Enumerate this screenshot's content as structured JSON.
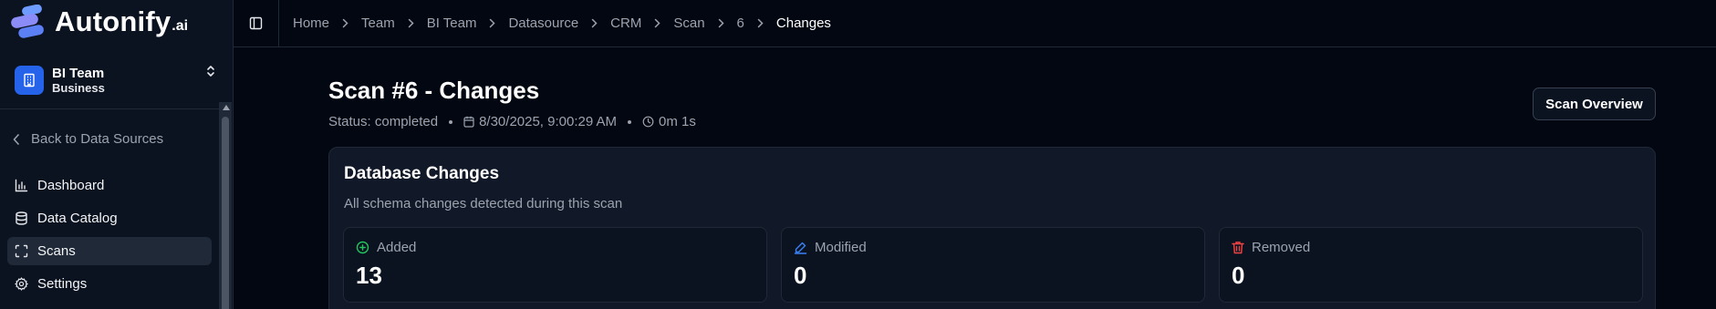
{
  "brand": {
    "name": "Autonify",
    "suffix": ".ai"
  },
  "team": {
    "name": "BI Team",
    "plan": "Business"
  },
  "sidebar": {
    "back_label": "Back to Data Sources",
    "items": [
      {
        "label": "Dashboard",
        "icon": "bar-chart-icon"
      },
      {
        "label": "Data Catalog",
        "icon": "database-icon"
      },
      {
        "label": "Scans",
        "icon": "scan-icon",
        "active": true
      },
      {
        "label": "Settings",
        "icon": "gear-icon"
      }
    ]
  },
  "breadcrumb": [
    "Home",
    "Team",
    "BI Team",
    "Datasource",
    "CRM",
    "Scan",
    "6",
    "Changes"
  ],
  "page": {
    "title": "Scan #6 - Changes",
    "status": "Status: completed",
    "date": "8/30/2025, 9:00:29 AM",
    "duration": "0m 1s",
    "overview_button": "Scan Overview"
  },
  "card": {
    "title": "Database Changes",
    "subtitle": "All schema changes detected during this scan",
    "stats": [
      {
        "label": "Added",
        "value": "13",
        "icon": "plus-circle-icon",
        "color": "#22c55e"
      },
      {
        "label": "Modified",
        "value": "0",
        "icon": "pencil-icon",
        "color": "#3b82f6"
      },
      {
        "label": "Removed",
        "value": "0",
        "icon": "trash-icon",
        "color": "#ef4444"
      }
    ]
  }
}
